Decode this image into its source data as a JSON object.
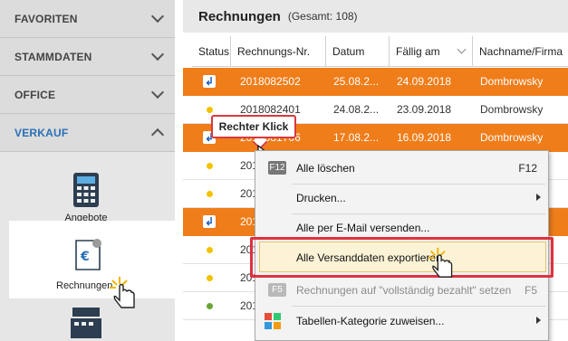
{
  "sidebar": {
    "sections": [
      {
        "label": "FAVORITEN",
        "expanded": false
      },
      {
        "label": "STAMMDATEN",
        "expanded": false
      },
      {
        "label": "OFFICE",
        "expanded": false
      },
      {
        "label": "VERKAUF",
        "expanded": true
      }
    ],
    "tiles": [
      {
        "label": "Angebote",
        "icon": "calculator-icon"
      },
      {
        "label": "Rechnungen",
        "icon": "invoice-euro-icon"
      }
    ]
  },
  "main": {
    "title": "Rechnungen",
    "count": "(Gesamt: 108)",
    "columns": [
      "Status",
      "Rechnungs-Nr.",
      "Datum",
      "Fällig am",
      "Nachname/Firma"
    ],
    "rows": [
      {
        "status": "arrow",
        "nr": "2018082502",
        "datum": "25.08.2...",
        "faellig": "24.09.2018",
        "name": "Dombrowsky",
        "selected": true
      },
      {
        "status": "yellow",
        "nr": "2018082401",
        "datum": "24.08.2...",
        "faellig": "23.09.2018",
        "name": "Dombrowsky",
        "selected": false
      },
      {
        "status": "arrow",
        "nr": "2018081706",
        "datum": "17.08.2...",
        "faellig": "16.09.2018",
        "name": "Dombrowsky",
        "selected": true
      },
      {
        "status": "yellow",
        "nr": "201",
        "datum": "",
        "faellig": "",
        "name": "",
        "selected": false
      },
      {
        "status": "yellow",
        "nr": "201",
        "datum": "",
        "faellig": "",
        "name": "",
        "selected": false
      },
      {
        "status": "arrow",
        "nr": "201",
        "datum": "",
        "faellig": "",
        "name": "",
        "selected": true
      },
      {
        "status": "yellow",
        "nr": "201",
        "datum": "",
        "faellig": "",
        "name": "",
        "selected": false
      },
      {
        "status": "yellow",
        "nr": "201",
        "datum": "",
        "faellig": "",
        "name": "",
        "selected": false
      },
      {
        "status": "green",
        "nr": "201",
        "datum": "",
        "faellig": "",
        "name": "",
        "selected": false
      }
    ]
  },
  "callout": {
    "text": "Rechter Klick"
  },
  "context_menu": {
    "items": [
      {
        "label": "Alle löschen",
        "underline": "A",
        "shortcut": "F12",
        "key": "F12",
        "disabled": false,
        "submenu": false
      },
      {
        "label": "Drucken...",
        "underline": "D",
        "shortcut": "",
        "key": "",
        "disabled": false,
        "submenu": true
      },
      {
        "label": "Alle per E-Mail versenden...",
        "underline": "A",
        "shortcut": "",
        "key": "",
        "disabled": false,
        "submenu": false
      },
      {
        "label": "Alle Versanddaten exportieren...",
        "underline": "A",
        "shortcut": "",
        "key": "",
        "disabled": false,
        "submenu": false,
        "highlighted": true
      },
      {
        "label": "Rechnungen auf \"vollständig bezahlt\" setzen",
        "underline": "",
        "shortcut": "F5",
        "key": "F5",
        "disabled": true,
        "submenu": false
      },
      {
        "label": "Tabellen-Kategorie zuweisen...",
        "underline": "T",
        "shortcut": "",
        "key": "",
        "disabled": false,
        "submenu": true
      }
    ]
  },
  "colors": {
    "selection": "#ef7d1a",
    "accent": "#2a6fb5",
    "highlight_frame": "#e0313f"
  }
}
